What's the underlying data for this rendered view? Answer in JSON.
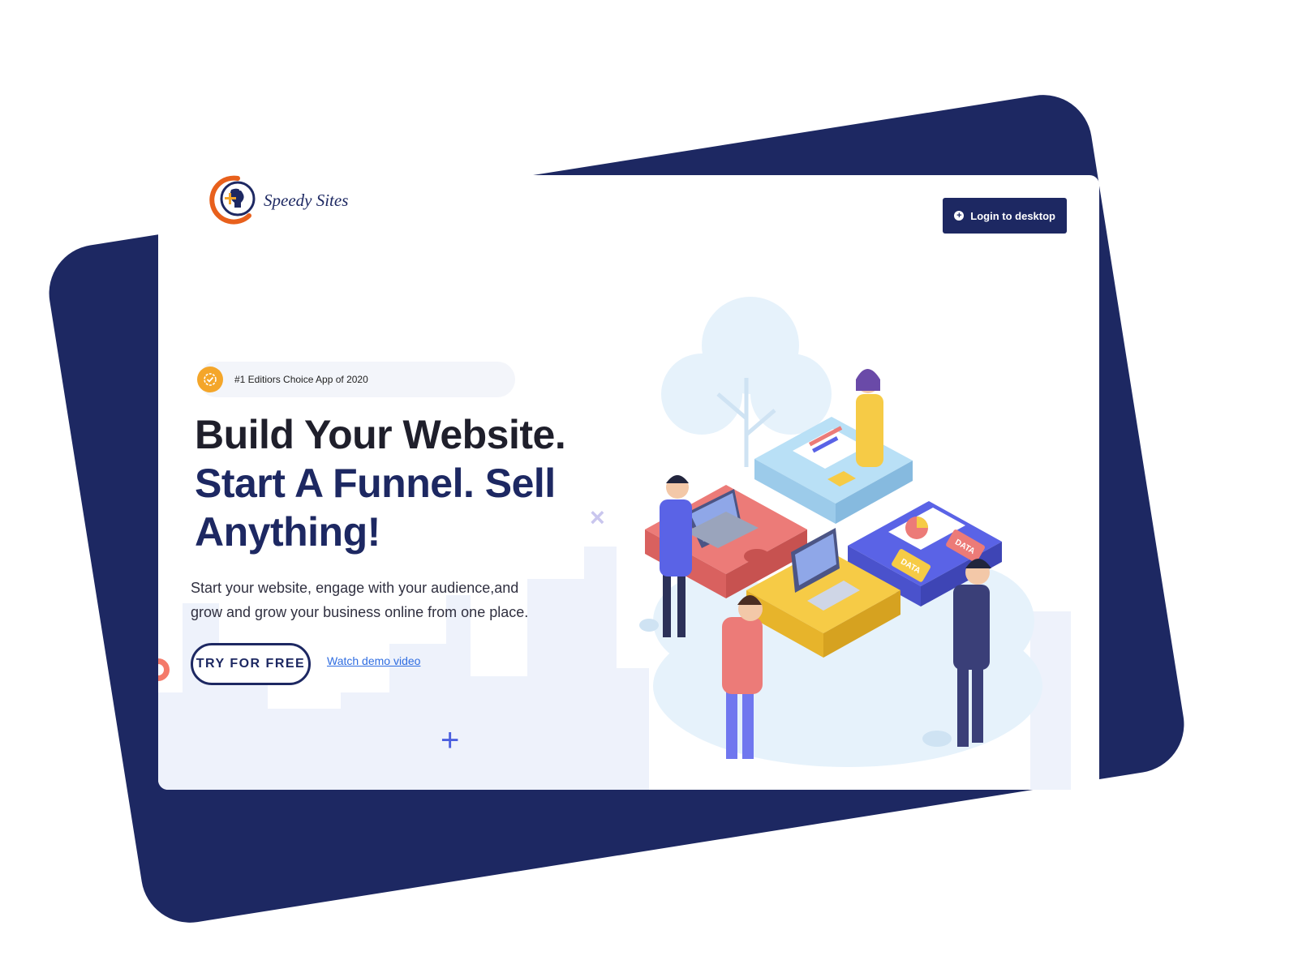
{
  "header": {
    "logo_text": "Speedy Sites",
    "login_label": "Login to desktop",
    "login_icon": "plus-circle-icon"
  },
  "hero": {
    "badge_icon": "verified-check-icon",
    "badge_text": "#1 Editiors Choice App of 2020",
    "headline_line1": "Build Your Website.",
    "headline_line2": "Start A Funnel. Sell",
    "headline_line3": "Anything!",
    "subtext": "Start your website, engage with your audience,and grow and grow your business online from one place.",
    "cta_label": "TRY FOR FREE",
    "demo_link": "Watch demo video"
  },
  "illustration": {
    "badge_left": "DATA",
    "badge_right": "DATA"
  },
  "colors": {
    "navy": "#1d2862",
    "accent_orange": "#f4a62a",
    "link_blue": "#2f6de1",
    "puzzle_red": "#ec7b78",
    "puzzle_yellow": "#f6cb46",
    "puzzle_blue": "#5a63e6",
    "puzzle_light": "#b9e0f6"
  }
}
